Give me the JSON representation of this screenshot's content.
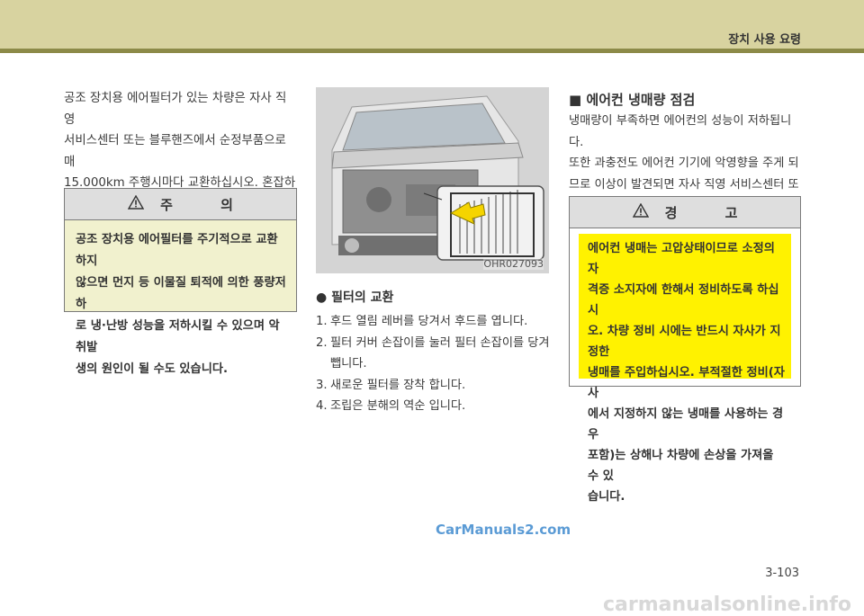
{
  "header": {
    "section_title": "장치 사용 요령"
  },
  "col1": {
    "paragraph": "공조 장치용 에어필터가 있는 차량은 자사 직영\n서비스센터 또는 블루핸즈에서 순정부품으로 매\n15.000km 주행시마다 교환하십시오. 혼잡하거나\n먼지가 많은 도로 주행시는 교환주기보다 더 자\n주 교환하십시오."
  },
  "caution": {
    "title": "주 의",
    "body": "공조 장치용 에어필터를 주기적으로 교환하지\n않으면 먼지 등 이물질 퇴적에 의한 풍량저하\n로 냉·난방 성능을 저하시킬 수 있으며 악취발\n생의 원인이 될 수도 있습니다."
  },
  "figure": {
    "code": "OHR027093",
    "icon": "car-filter-illustration"
  },
  "filter_replacement": {
    "heading": "● 필터의 교환",
    "steps": [
      {
        "num": "1.",
        "text": "후드 열림 레버를 당겨서 후드를 엽니다."
      },
      {
        "num": "2.",
        "text": "필터 커버 손잡이를 눌러 필터 손잡이를 당겨\n뺍니다."
      },
      {
        "num": "3.",
        "text": "새로운 필터를 장착 합니다."
      },
      {
        "num": "4.",
        "text": "조립은 분해의 역순 입니다."
      }
    ]
  },
  "refrigerant": {
    "heading": "■ 에어컨 냉매량 점검",
    "paragraph": "냉매량이 부족하면 에어컨의 성능이 저하됩니다.\n또한 과충전도 에어컨 기기에 악영향을 주게 되\n므로 이상이 발견되면 자사 직영 서비스센터 또\n는 블루핸즈에서 점검을 받으십시오."
  },
  "warning": {
    "title": "경 고",
    "body": "에어컨 냉매는 고압상태이므로 소정의 자\n격증 소지자에 한해서 정비하도록 하십시\n오. 차량 정비 시에는 반드시 자사가 지정한\n냉매를 주입하십시오. 부적절한 정비(자사\n에서 지정하지 않는 냉매를 사용하는 경우\n포함)는 상해나 차량에 손상을 가져올 수 있\n습니다."
  },
  "footer": {
    "page_number": "3-103",
    "watermark_mid": "CarManuals2.com",
    "watermark_bottom": "carmanualsonline.info"
  },
  "colors": {
    "header_band": "#d8d3a0",
    "header_rule": "#8c8a48",
    "caution_bg": "#f1f1ce",
    "warning_bg": "#fff200",
    "watermark_blue": "#5b9bd5"
  }
}
